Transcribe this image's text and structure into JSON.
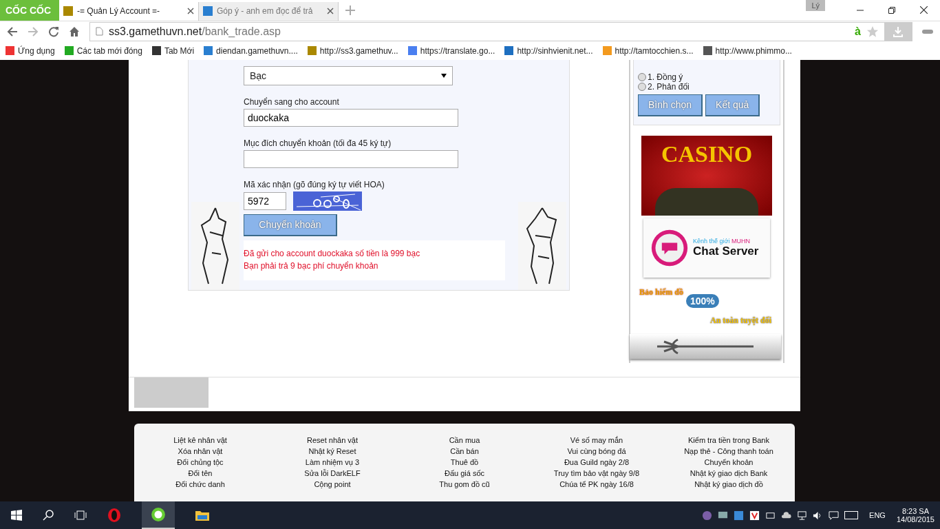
{
  "browser": {
    "logo": "CỐC CỐC",
    "tabs": [
      {
        "title": "-= Quản Lý Account =-",
        "selected": true
      },
      {
        "title": "Góp ý - anh em đọc để trả",
        "selected": false
      }
    ],
    "profile": "Lý",
    "ime": "à",
    "address": {
      "host": "ss3.gamethuvn.net",
      "path": "/bank_trade.asp"
    },
    "bookmarks": [
      {
        "label": "Ứng dụng",
        "kind": "apps"
      },
      {
        "label": "Các tab mới đóng",
        "kind": "history"
      },
      {
        "label": "Tab Mới",
        "kind": "camera"
      },
      {
        "label": "diendan.gamethuvn....",
        "kind": "g"
      },
      {
        "label": "http://ss3.gamethuv...",
        "kind": "game"
      },
      {
        "label": "https://translate.go...",
        "kind": "translate"
      },
      {
        "label": "http://sinhvienit.net...",
        "kind": "sv"
      },
      {
        "label": "http://tamtocchien.s...",
        "kind": "orange"
      },
      {
        "label": "http://www.phimmo...",
        "kind": "film"
      }
    ]
  },
  "form": {
    "asset_select": "Bạc",
    "fields": [
      {
        "label": "Chuyển sang cho account",
        "value": "duockaka"
      },
      {
        "label": "Mục đích chuyển khoản (tối đa 45 ký tự)"
      }
    ],
    "captcha": {
      "label": "Mã xác nhận (gõ đúng ký tự viết HOA)",
      "value": "5972"
    },
    "submit": "Chuyển khoản",
    "messages": [
      "Đã gửi cho account duockaka số tiền là 999 bạc",
      "Bạn phải trả 9 bạc phí chuyển khoản"
    ]
  },
  "poll": {
    "options": [
      {
        "label": "1. Đồng ý",
        "selected": false
      },
      {
        "label": "2. Phản đối",
        "selected": false
      }
    ],
    "buttons": [
      "Bình chọn",
      "Kết quả"
    ]
  },
  "banners": {
    "casino": "CASINO",
    "chat_caption": "Kênh thế giới",
    "chat_brand": "MUHN",
    "chat_title": "Chat Server",
    "insurance": "Bảo hiểm đồ",
    "insurance_badge": "100%",
    "insurance_tagline": "An toàn tuyệt đối"
  },
  "footer": {
    "columns": [
      [
        "Liệt kê nhân vật",
        "Xóa nhân vật",
        "Đổi chủng tộc",
        "Đổi tên",
        "Đổi chức danh"
      ],
      [
        "Reset nhân vật",
        "Nhật ký Reset",
        "Làm nhiệm vụ 3",
        "Sửa lỗi DarkELF",
        "Cộng point"
      ],
      [
        "Cần mua",
        "Cần bán",
        "Thuê đồ",
        "Đấu giá sốc",
        "Thu gom đồ cũ"
      ],
      [
        "Vé số may mắn",
        "Vui cùng bóng đá",
        "Đua Guild ngày 2/8",
        "Truy tìm bảo vật ngày 9/8",
        "Chúa tể PK ngày 16/8"
      ],
      [
        "Kiểm tra tiền trong Bank",
        "Nạp thẻ - Công thanh toán",
        "Chuyển khoản",
        "Nhật ký giao dịch Bank",
        "Nhật ký giao dịch đồ"
      ]
    ]
  },
  "taskbar": {
    "language": "ENG",
    "time": "8:23 SA",
    "date": "14/08/2015"
  }
}
